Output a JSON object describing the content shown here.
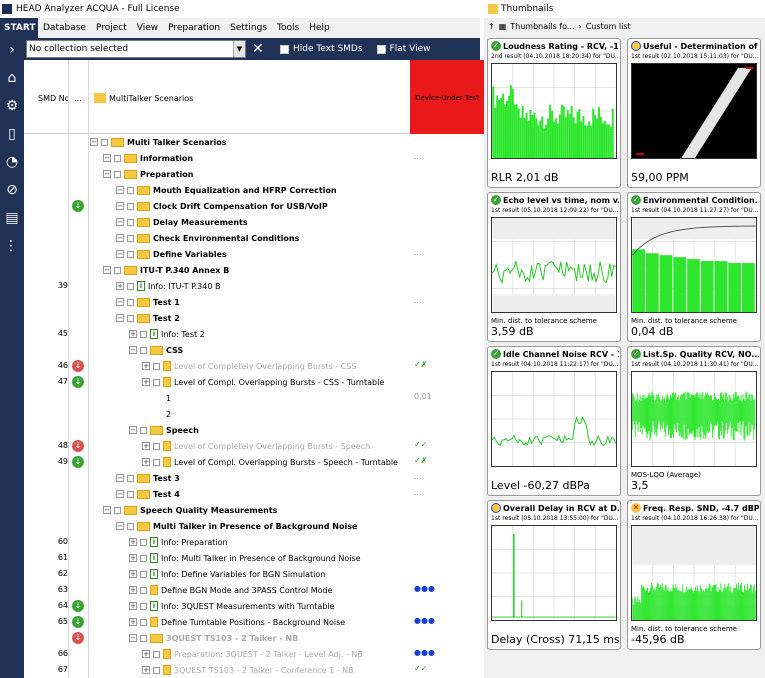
{
  "app": {
    "title": "HEAD Analyzer ACQUA - Full License"
  },
  "menu": {
    "start": "START",
    "items": [
      "Database",
      "Project",
      "View",
      "Preparation",
      "Settings",
      "Tools",
      "Help"
    ]
  },
  "toolbar": {
    "collection": "No collection selected",
    "hide_text_smds": "Hide Text SMDs",
    "flat_view": "Flat View"
  },
  "columns": {
    "smd_no": "SMD No",
    "dots": "...",
    "scenarios": "MultiTalker Scenarios",
    "device": "Device-Under Test"
  },
  "tree": [
    {
      "num": "",
      "indent": 0,
      "label": "Multi Talker Scenarios",
      "bold": true,
      "icon": "folder"
    },
    {
      "num": "",
      "indent": 1,
      "label": "Information",
      "bold": true,
      "icon": "folder",
      "dev": "..."
    },
    {
      "num": "",
      "indent": 1,
      "label": "Preparation",
      "bold": true,
      "icon": "folder"
    },
    {
      "num": "",
      "indent": 2,
      "label": "Mouth Equalization and HFRP Correction",
      "bold": true,
      "icon": "folder"
    },
    {
      "num": "",
      "indent": 2,
      "label": "Clock Drift Compensation for USB/VoIP",
      "bold": true,
      "icon": "folder",
      "status": "green"
    },
    {
      "num": "",
      "indent": 2,
      "label": "Delay Measurements",
      "bold": true,
      "icon": "folder"
    },
    {
      "num": "",
      "indent": 2,
      "label": "Check Environmental Conditions",
      "bold": true,
      "icon": "folder"
    },
    {
      "num": "",
      "indent": 2,
      "label": "Define Variables",
      "bold": true,
      "icon": "folder",
      "dev": "..."
    },
    {
      "num": "",
      "indent": 1,
      "label": "ITU-T P.340 Annex B",
      "bold": true,
      "icon": "folder"
    },
    {
      "num": "39",
      "indent": 2,
      "label": "Info: ITU-T P.340 B",
      "icon": "info"
    },
    {
      "num": "",
      "indent": 2,
      "label": "Test 1",
      "bold": true,
      "icon": "folder",
      "dev": "..."
    },
    {
      "num": "",
      "indent": 2,
      "label": "Test 2",
      "bold": true,
      "icon": "folder"
    },
    {
      "num": "45",
      "indent": 3,
      "label": "Info: Test 2",
      "icon": "info"
    },
    {
      "num": "",
      "indent": 3,
      "label": "CSS",
      "bold": true,
      "icon": "folder"
    },
    {
      "num": "46",
      "indent": 4,
      "label": "Level of Completely Overlapping Bursts - CSS",
      "grey": true,
      "icon": "doc",
      "status": "red",
      "dev": "✓✗"
    },
    {
      "num": "47",
      "indent": 4,
      "label": "Level of Compl. Overlapping Bursts - CSS - Turntable",
      "icon": "doc",
      "status": "green"
    },
    {
      "num": "",
      "indent": 5,
      "label": "1",
      "icon": "none",
      "dev": "0,01"
    },
    {
      "num": "",
      "indent": 5,
      "label": "2",
      "icon": "none"
    },
    {
      "num": "",
      "indent": 3,
      "label": "Speech",
      "bold": true,
      "icon": "folder"
    },
    {
      "num": "48",
      "indent": 4,
      "label": "Level of Completely Overlapping Bursts - Speech",
      "grey": true,
      "icon": "doc",
      "status": "red",
      "dev": "✓✓"
    },
    {
      "num": "49",
      "indent": 4,
      "label": "Level of Compl. Overlapping Bursts - Speech - Turntable",
      "icon": "doc",
      "status": "green",
      "dev": "✓✗"
    },
    {
      "num": "",
      "indent": 2,
      "label": "Test 3",
      "bold": true,
      "icon": "folder",
      "dev": "..."
    },
    {
      "num": "",
      "indent": 2,
      "label": "Test 4",
      "bold": true,
      "icon": "folder",
      "dev": "..."
    },
    {
      "num": "",
      "indent": 1,
      "label": "Speech Quality Measurements",
      "bold": true,
      "icon": "folder"
    },
    {
      "num": "",
      "indent": 2,
      "label": "Multi Talker in Presence of Background Noise",
      "bold": true,
      "icon": "folder"
    },
    {
      "num": "60",
      "indent": 3,
      "label": "Info: Preparation",
      "icon": "info"
    },
    {
      "num": "61",
      "indent": 3,
      "label": "Info: Multi Talker in Presence of Background Noise",
      "icon": "info"
    },
    {
      "num": "62",
      "indent": 3,
      "label": "Info: Define Variables for BGN Simulation",
      "icon": "info"
    },
    {
      "num": "63",
      "indent": 3,
      "label": "Define BGN Mode and 3PASS Control Mode",
      "icon": "doc",
      "dev": "●●●"
    },
    {
      "num": "64",
      "indent": 3,
      "label": "Info: 3QUEST Measurements with Turntable",
      "icon": "info",
      "status": "green"
    },
    {
      "num": "65",
      "indent": 3,
      "label": "Define Turntable Positions - Background Noise",
      "icon": "doc",
      "status": "green",
      "dev": "●●●"
    },
    {
      "num": "",
      "indent": 3,
      "label": "3QUEST TS103 - 2 Talker - NB",
      "bold": true,
      "grey": true,
      "icon": "folder",
      "status": "red"
    },
    {
      "num": "66",
      "indent": 4,
      "label": "Preparation: 3QUEST - 2 Talker - Level Adj. - NB",
      "grey": true,
      "icon": "doc",
      "dev": "●●●"
    },
    {
      "num": "67",
      "indent": 4,
      "label": "3QUEST TS103 - 2 Talker - Conference 1 - NB",
      "grey": true,
      "icon": "doc",
      "dev": "✓✓"
    }
  ],
  "thumbnails": {
    "title": "Thumbnails",
    "toolbar_folder": "Thumbnails fo...",
    "custom_list": "Custom list",
    "cards": [
      {
        "title": "Loudness Rating - RCV, -1...",
        "sub": "2nd result (04.10.2018 18:20:34) for \"DU...",
        "label": "",
        "value_name": "RLR",
        "value": "2,01 dB",
        "badge": "check",
        "kind": "bars"
      },
      {
        "title": "Useful - Determination of ...",
        "sub": "1st result (02.10.2018 15:11:03) for \"DU...",
        "label": "",
        "value_name": "",
        "value": "59,00 PPM",
        "badge": "dot",
        "kind": "diag"
      },
      {
        "title": "Echo level vs time, nom v...",
        "sub": "1st result (05.10.2018 12:09:22) for \"DU...",
        "label": "Min. dist. to tolerance scheme",
        "value_name": "",
        "value": "3,59 dB",
        "badge": "check",
        "kind": "noise"
      },
      {
        "title": "Environmental Condition...",
        "sub": "1st result (04.10.2018 11:27:27) for \"DU...",
        "label": "Min. dist. to tolerance scheme",
        "value_name": "",
        "value": "0,04 dB",
        "badge": "check",
        "kind": "steps"
      },
      {
        "title": "Idle Channel Noise RCV - 1...",
        "sub": "1st result (04.10.2018 11:22:17) for \"DU...",
        "label": "",
        "value_name": "Level",
        "value": "-60,27 dBPa",
        "badge": "check",
        "kind": "spectrum"
      },
      {
        "title": "List.Sp. Quality RCV, NO...",
        "sub": "1st result (04.10.2018 11:30:41) for \"DU...",
        "label": "MOS-LQO (Average)",
        "value_name": "",
        "value": "3,5",
        "badge": "check",
        "kind": "dense"
      },
      {
        "title": "Overall Delay in RCV at D...",
        "sub": "1st result (05.10.2018 13:55:00) for \"DU...",
        "label": "",
        "value_name": "Delay (Cross)",
        "value": "71,15 ms",
        "badge": "dot",
        "kind": "spike"
      },
      {
        "title": "Freq. Resp. SND, -4.7 dBPa...",
        "sub": "1st result (04.10.2018 16:26:38) for \"DU...",
        "label": "Min. dist. to tolerance scheme",
        "value_name": "",
        "value": "-45,96 dB",
        "badge": "cross",
        "kind": "freq"
      }
    ]
  }
}
